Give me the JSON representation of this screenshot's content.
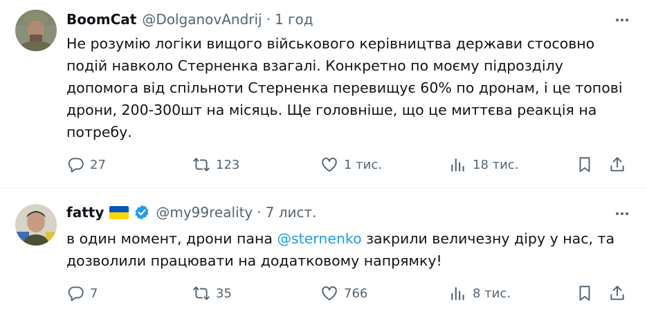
{
  "tweets": [
    {
      "name": "BoomCat",
      "handle": "@DolganovAndrij",
      "separator": "·",
      "time": "1 год",
      "text": "Не розумію логіки вищого військового керівництва держави стосовно\nподій навколо Стерненка взагалі. Конкретно по моєму підрозділу\nдопомога від спільноти Стерненка перевищує 60% по дронам, і це топові\nдрони,    200-300шт на місяць. Ще головніше, що це миттєва реакція на\nпотребу.",
      "replies": "27",
      "reposts": "123",
      "likes": "1 тис.",
      "views": "18 тис."
    },
    {
      "name": "fatty",
      "handle": "@my99reality",
      "separator": "·",
      "time": "7 лист.",
      "text_before": "в один момент, дрони пана ",
      "mention": "@sternenko",
      "text_after": " закрили величезну діру у нас, та\nдозволили працювати на додатковому напрямку!",
      "replies": "7",
      "reposts": "35",
      "likes": "766",
      "views": "8 тис."
    }
  ],
  "colors": {
    "text": "#0f1419",
    "secondary": "#536471",
    "link": "#1d9bf0",
    "divider": "#eff3f4",
    "flag_blue": "#0057b7",
    "flag_yellow": "#ffd700"
  },
  "icons": [
    "more-icon",
    "reply-icon",
    "repost-icon",
    "like-icon",
    "views-icon",
    "bookmark-icon",
    "share-icon",
    "verified-badge-icon"
  ]
}
